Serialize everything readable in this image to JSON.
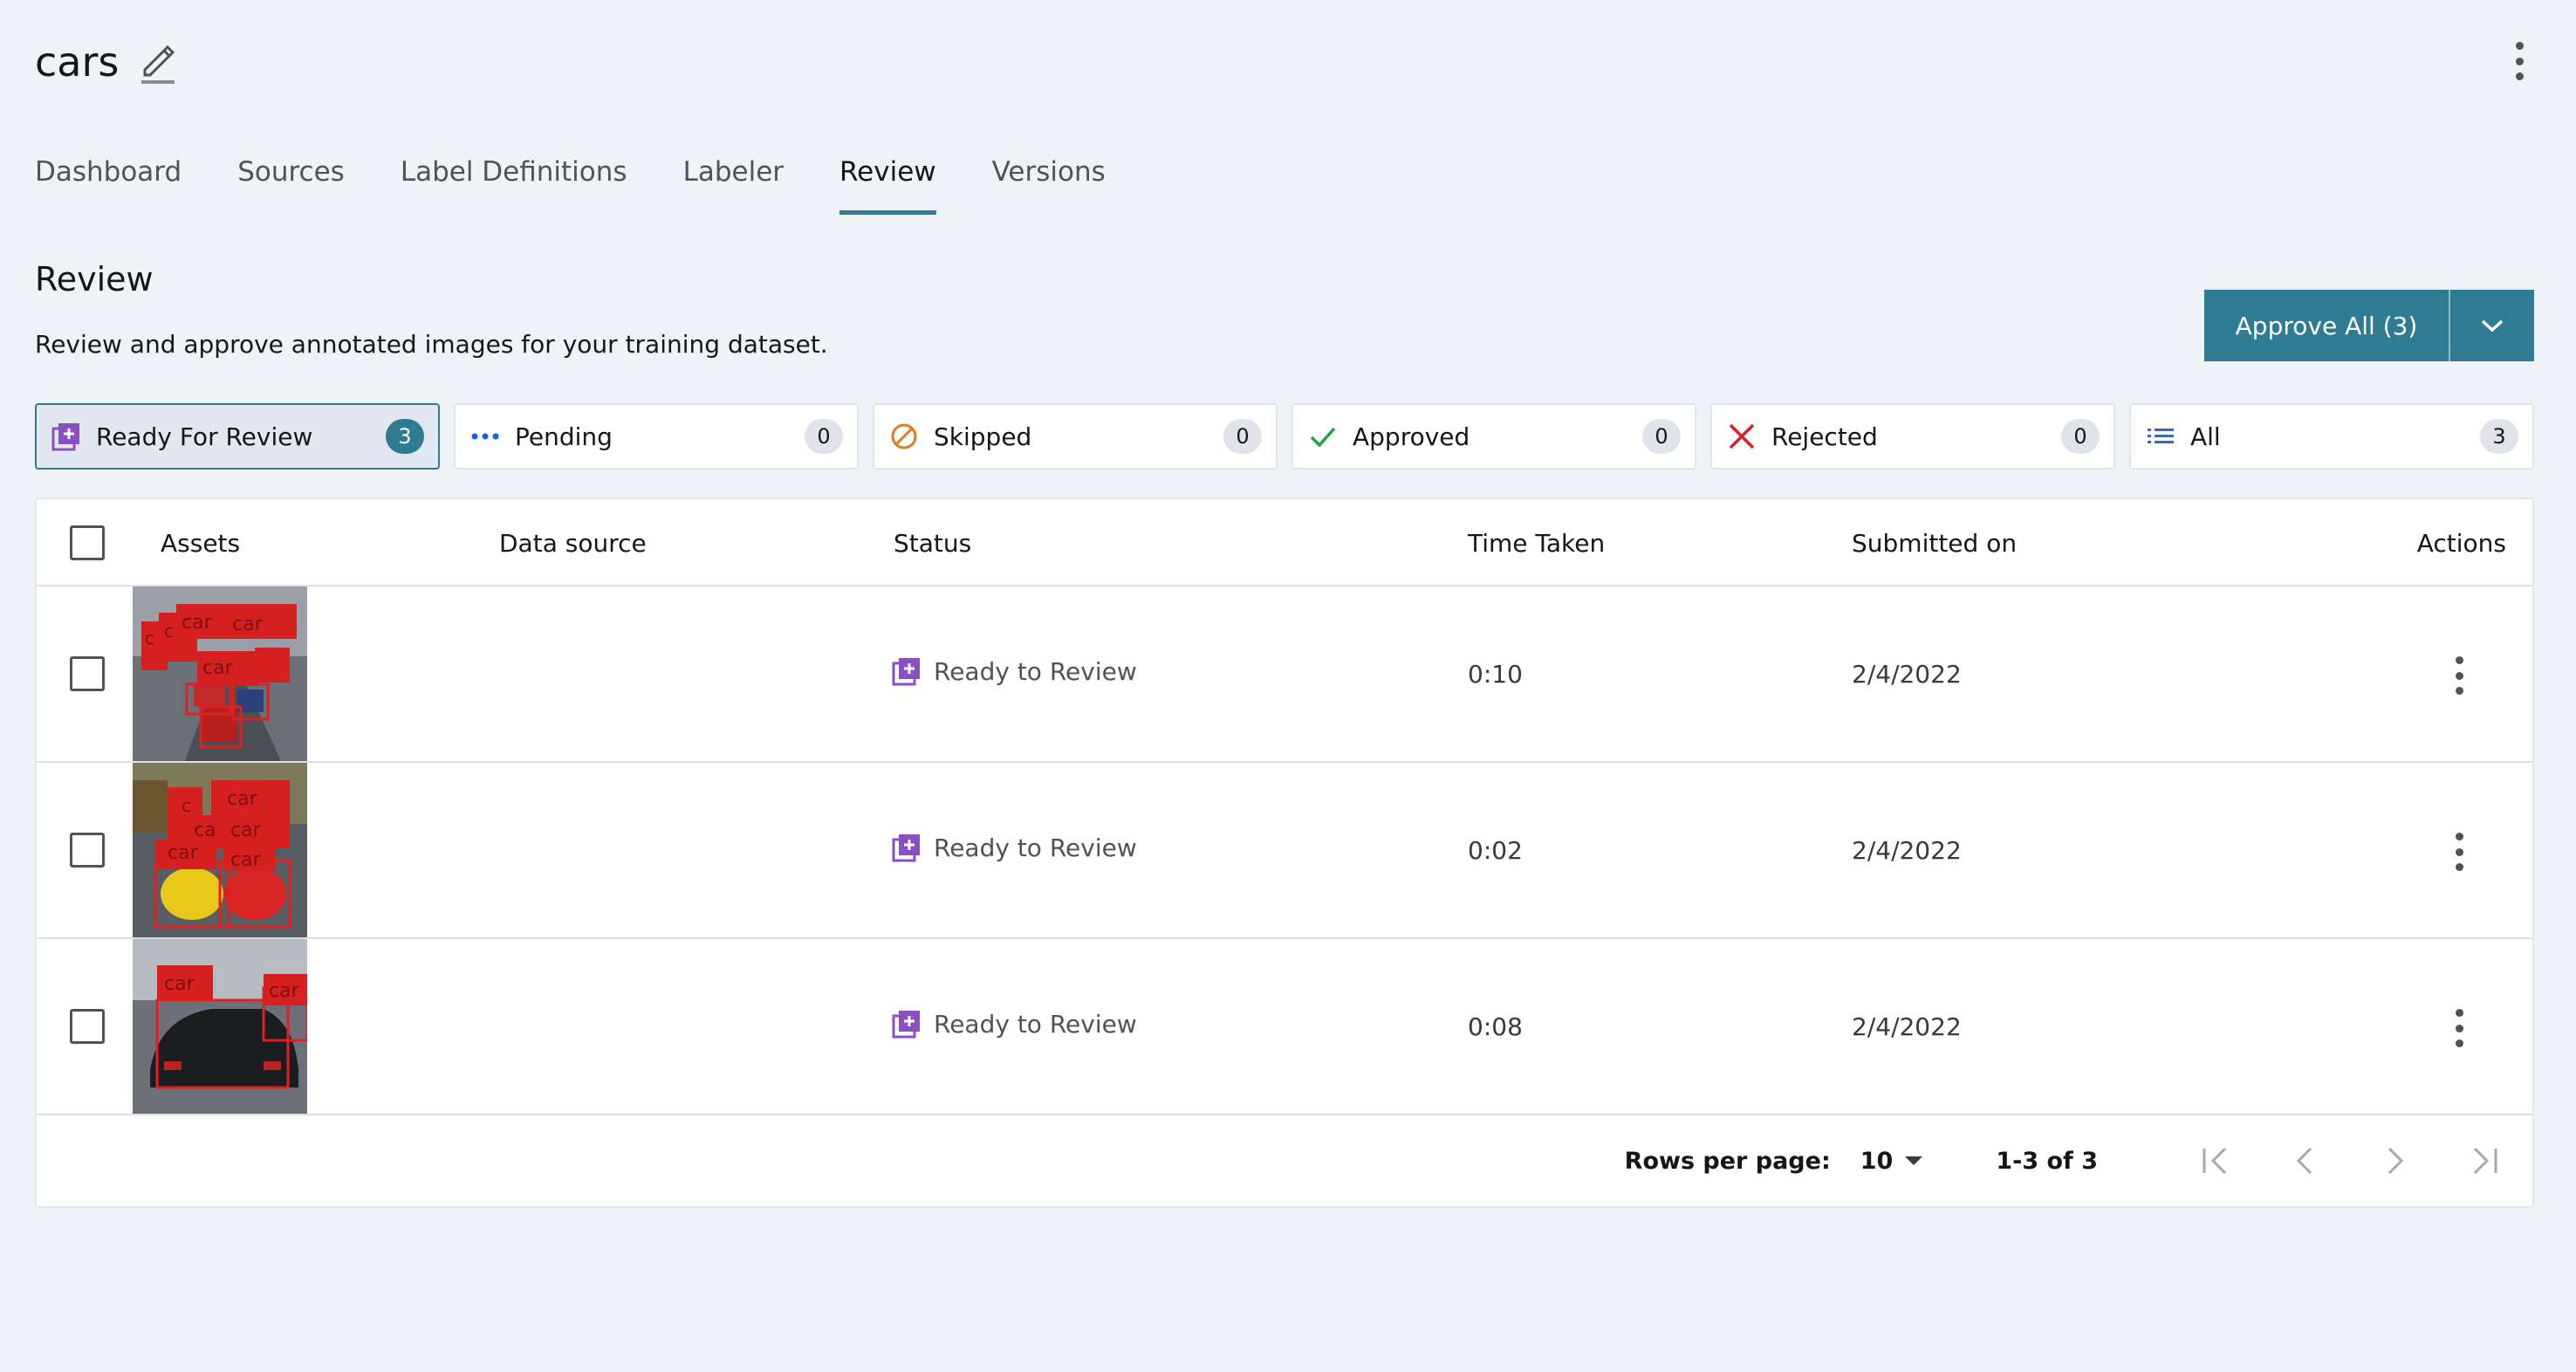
{
  "header": {
    "title": "cars"
  },
  "tabs": [
    {
      "label": "Dashboard",
      "active": false
    },
    {
      "label": "Sources",
      "active": false
    },
    {
      "label": "Label Definitions",
      "active": false
    },
    {
      "label": "Labeler",
      "active": false
    },
    {
      "label": "Review",
      "active": true
    },
    {
      "label": "Versions",
      "active": false
    }
  ],
  "section": {
    "title": "Review",
    "description": "Review and approve annotated images for your training dataset."
  },
  "approve": {
    "label": "Approve All (3)"
  },
  "filters": [
    {
      "label": "Ready For Review",
      "count": "3",
      "icon": "ready-review-icon",
      "active": true
    },
    {
      "label": "Pending",
      "count": "0",
      "icon": "pending-dots-icon",
      "active": false
    },
    {
      "label": "Skipped",
      "count": "0",
      "icon": "skipped-icon",
      "active": false
    },
    {
      "label": "Approved",
      "count": "0",
      "icon": "check-icon",
      "active": false
    },
    {
      "label": "Rejected",
      "count": "0",
      "icon": "close-icon",
      "active": false
    },
    {
      "label": "All",
      "count": "3",
      "icon": "list-icon",
      "active": false
    }
  ],
  "table": {
    "headers": {
      "assets": "Assets",
      "data_source": "Data source",
      "status": "Status",
      "time_taken": "Time Taken",
      "submitted_on": "Submitted on",
      "actions": "Actions"
    },
    "rows": [
      {
        "data_source": "",
        "status": "Ready to Review",
        "time_taken": "0:10",
        "submitted_on": "2/4/2022"
      },
      {
        "data_source": "",
        "status": "Ready to Review",
        "time_taken": "0:02",
        "submitted_on": "2/4/2022"
      },
      {
        "data_source": "",
        "status": "Ready to Review",
        "time_taken": "0:08",
        "submitted_on": "2/4/2022"
      }
    ],
    "thumb_labels": {
      "row0": [
        "car",
        "car",
        "car",
        "c",
        "c"
      ],
      "row1": [
        "car",
        "car",
        "car",
        "car",
        "ca",
        "c"
      ],
      "row2": [
        "car",
        "car"
      ]
    }
  },
  "pagination": {
    "rows_per_page_label": "Rows per page:",
    "rows_per_page": "10",
    "range": "1-3 of 3"
  },
  "colors": {
    "accent": "#2f7b92",
    "status_purple": "#8a4fc2",
    "approved_green": "#24a148",
    "rejected_red": "#da1e28",
    "skipped_orange": "#e07b24",
    "pending_blue": "#0f62fe"
  }
}
